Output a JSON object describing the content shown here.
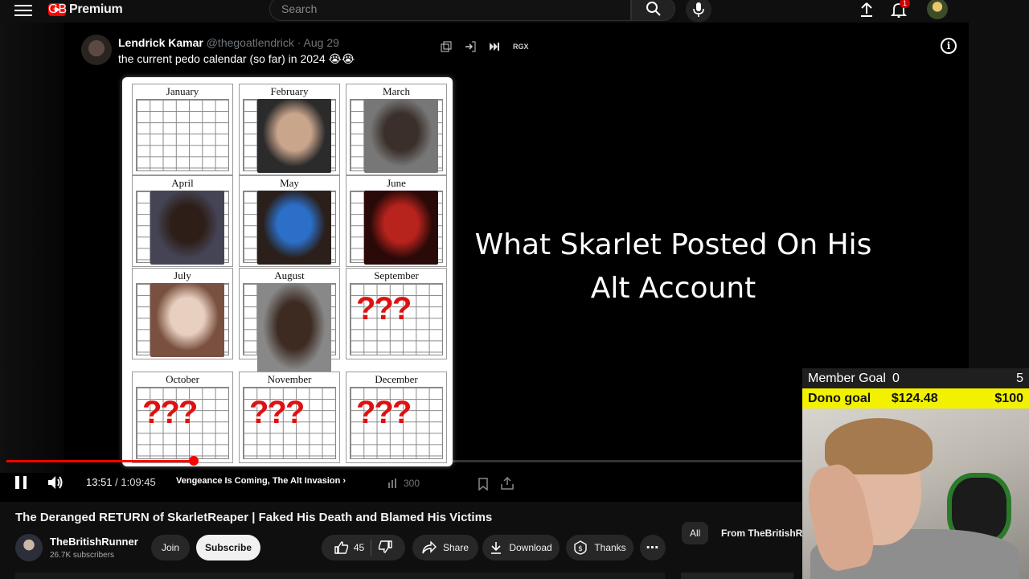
{
  "header": {
    "logo_text": "Premium",
    "logo_region": "GB",
    "search_placeholder": "Search",
    "notification_count": "1"
  },
  "player": {
    "tweet": {
      "name": "Lendrick Kamar",
      "handle": "@thegoatlendrick · Aug 29",
      "text": "the current pedo calendar (so far) in 2024 😭😭"
    },
    "tool_rgx": "RGX",
    "info_label": "i",
    "calendar_months": [
      "January",
      "February",
      "March",
      "April",
      "May",
      "June",
      "July",
      "August",
      "September",
      "October",
      "November",
      "December"
    ],
    "question_marks": "???",
    "overlay_title": "What Skarlet Posted On His Alt Account",
    "progress": 0.233,
    "current_time": "13:51",
    "duration": "1:09:45",
    "time_separator": " / ",
    "chapter": "Vengeance Is Coming, The Alt Invasion",
    "views_count": "300"
  },
  "video": {
    "title": "The Deranged RETURN of SkarletReaper | Faked His Death and Blamed His Victims",
    "channel_name": "TheBritishRunner",
    "subscribers": "26.7K subscribers",
    "join_label": "Join",
    "subscribe_label": "Subscribe",
    "like_count": "45",
    "share_label": "Share",
    "download_label": "Download",
    "thanks_label": "Thanks"
  },
  "sidebar_chips": {
    "all": "All",
    "from_channel": "From TheBritishRur"
  },
  "stream_overlay": {
    "member_goal_label": "Member Goal",
    "member_goal_value": "0",
    "member_goal_target": "5",
    "dono_goal_label": "Dono goal",
    "dono_goal_value": "$124.48",
    "dono_goal_target": "$100"
  },
  "colors": {
    "brand_red": "#ff0000",
    "dono_yellow": "#f2f200",
    "background": "#0f0f0f"
  }
}
